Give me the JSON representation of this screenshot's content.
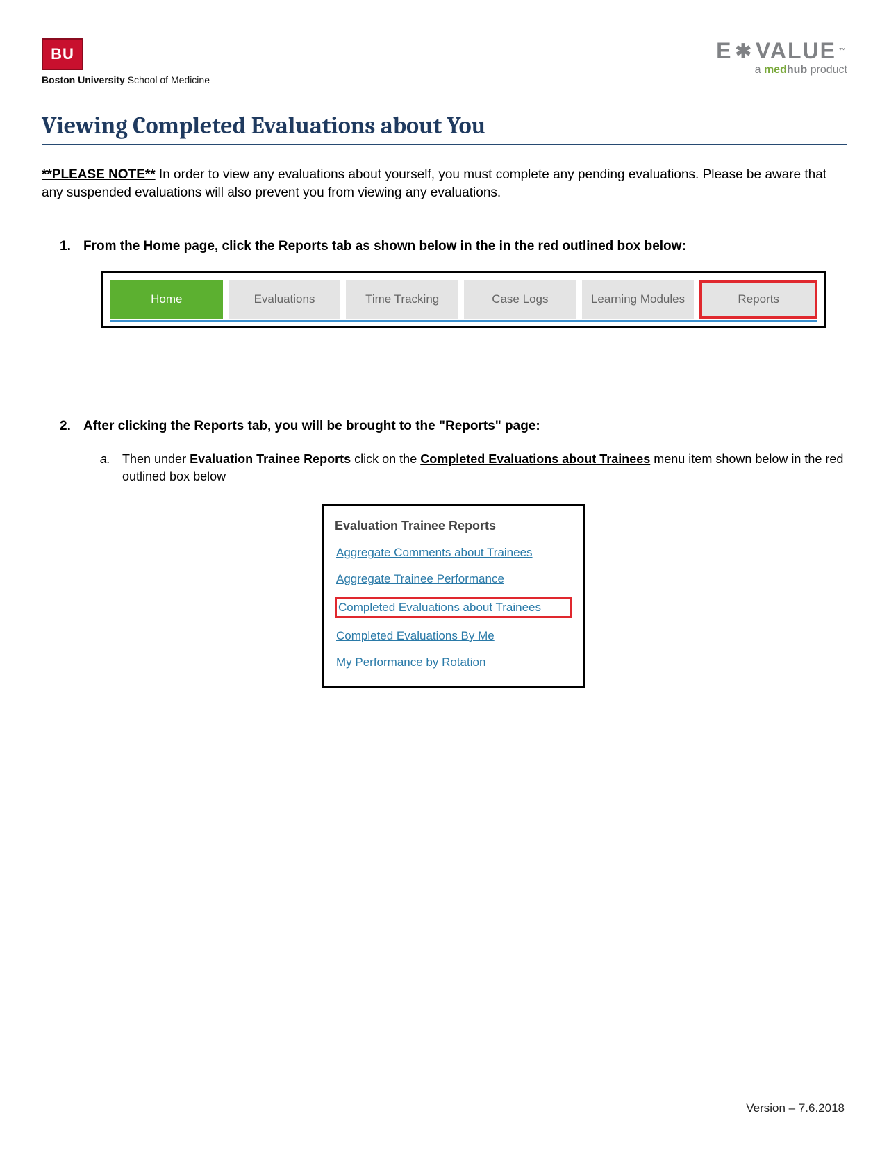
{
  "header": {
    "bu_logo_text": "BU",
    "bu_school": "Boston University",
    "bu_school_suffix": " School of Medicine",
    "evalue_brand_e": "E",
    "evalue_brand_star": "✱",
    "evalue_brand_value": "VALUE",
    "evalue_tm": "™",
    "evalue_sub_prefix": "a ",
    "evalue_sub_med": "med",
    "evalue_sub_hub": "hub",
    "evalue_sub_suffix": " product"
  },
  "title": "Viewing Completed Evaluations about You",
  "note": {
    "label": "**PLEASE NOTE**",
    "text": " In order to view any evaluations about yourself, you must complete any pending evaluations. Please be aware that any suspended evaluations will also prevent you from viewing any evaluations."
  },
  "steps": [
    {
      "num": "1.",
      "heading": "From the Home page, click the Reports tab as shown below in the in the red outlined box below:",
      "tabs": [
        {
          "label": "Home",
          "active": true
        },
        {
          "label": "Evaluations"
        },
        {
          "label": "Time Tracking"
        },
        {
          "label": "Case Logs"
        },
        {
          "label": "Learning Modules"
        },
        {
          "label": "Reports",
          "outlined": true
        }
      ]
    },
    {
      "num": "2.",
      "heading": "After clicking the Reports tab, you will be brought to the \"Reports\" page:",
      "sub": {
        "letter": "a.",
        "pre": "Then under ",
        "bold1": "Evaluation Trainee Reports",
        "mid": " click on the ",
        "bold2_underlined": "Completed Evaluations about Trainees",
        "post": " menu item shown below in the red outlined box below"
      },
      "menu": {
        "title": "Evaluation Trainee Reports",
        "items": [
          {
            "label": "Aggregate Comments about Trainees"
          },
          {
            "label": "Aggregate Trainee Performance"
          },
          {
            "label": "Completed Evaluations about Trainees",
            "outlined": true
          },
          {
            "label": "Completed Evaluations By Me"
          },
          {
            "label": "My Performance by Rotation"
          }
        ]
      }
    }
  ],
  "footer": "Version – 7.6.2018"
}
